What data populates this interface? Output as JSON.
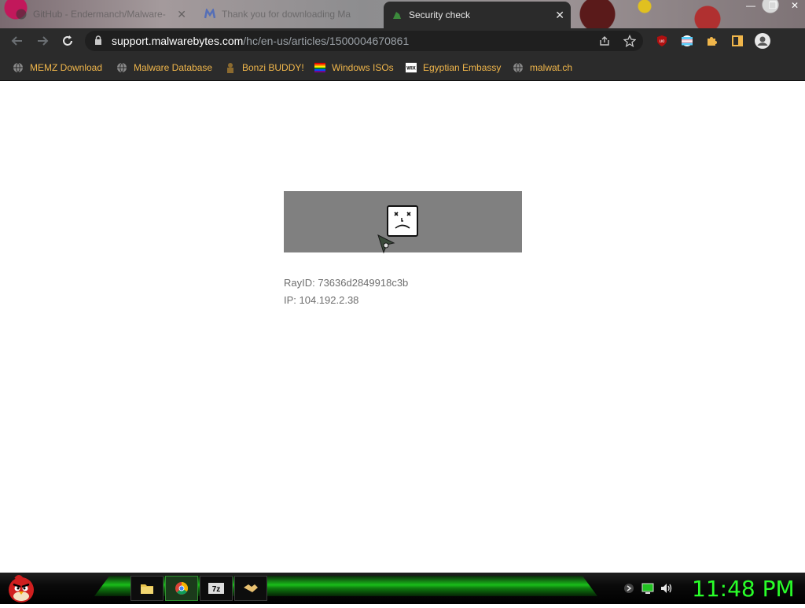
{
  "window": {
    "tabs": [
      {
        "label": "GitHub - Endermanch/Malware-",
        "state": "inactive",
        "icon": "github-icon"
      },
      {
        "label": "Thank you for downloading Ma",
        "state": "inactive",
        "icon": "malwarebytes-icon"
      },
      {
        "label": "Security check",
        "state": "active",
        "icon": "cloudflare-icon"
      }
    ],
    "controls": {
      "minimize": "—",
      "maximize": "❐",
      "close": "✕"
    }
  },
  "toolbar": {
    "url_host": "support.malwarebytes.com",
    "url_path": "/hc/en-us/articles/1500004670861",
    "buttons": [
      "back-icon",
      "forward-icon",
      "reload-icon"
    ],
    "omnibox_icons": [
      "share-icon",
      "star-icon"
    ],
    "extensions": [
      "ublock-icon",
      "flag-extension-icon",
      "puzzle-icon",
      "sidepanel-icon",
      "profile-icon"
    ]
  },
  "bookmarks": [
    {
      "label": "MEMZ Download",
      "icon": "globe-icon"
    },
    {
      "label": "Malware Database",
      "icon": "globe-icon"
    },
    {
      "label": "Bonzi BUDDY!",
      "icon": "bonzi-icon"
    },
    {
      "label": "Windows ISOs",
      "icon": "rainbow-flag-icon"
    },
    {
      "label": "Egyptian Embassy",
      "icon": "wix-icon"
    },
    {
      "label": "malwat.ch",
      "icon": "globe-icon"
    }
  ],
  "content": {
    "ray_id": "RayID: 73636d2849918c3b",
    "ip": "IP: 104.192.2.38",
    "error_icon": "sad-face-icon"
  },
  "taskbar": {
    "start_icon": "angry-bird-icon",
    "apps": [
      "file-explorer-icon",
      "chrome-icon",
      "7zip-icon",
      "handshake-icon"
    ],
    "tray": [
      "fidget-spinner-icon",
      "monitor-icon",
      "volume-icon"
    ],
    "clock": "11:48 PM"
  },
  "colors": {
    "accent_bookmark": "#f0b64b",
    "clock": "#29ff29",
    "toolbar_bg": "#2b2b2b",
    "error_box": "#808080"
  }
}
